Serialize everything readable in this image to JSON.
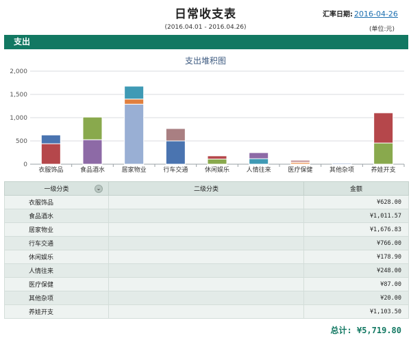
{
  "header": {
    "title": "日常收支表",
    "rate_label": "汇率日期:",
    "rate_date": "2016-04-26",
    "period": "(2016.04.01 - 2016.04.26)",
    "unit": "(单位:元)"
  },
  "section": {
    "title": "支出"
  },
  "chart_data": {
    "type": "bar",
    "stacked": true,
    "title": "支出堆积图",
    "ylim": [
      0,
      2000
    ],
    "yticks": [
      "0",
      "500",
      "1,000",
      "1,500",
      "2,000"
    ],
    "grid": true,
    "categories": [
      "衣服饰品",
      "食品酒水",
      "居家物业",
      "行车交通",
      "休闲娱乐",
      "人情往来",
      "医疗保健",
      "其他杂项",
      "养娃开支"
    ],
    "stacks": [
      [
        {
          "v": 440,
          "c": "#b5474b"
        },
        {
          "v": 188,
          "c": "#4a74b0"
        }
      ],
      [
        {
          "v": 526,
          "c": "#8d6aa6"
        },
        {
          "v": 486,
          "c": "#89a94d"
        }
      ],
      [
        {
          "v": 1290,
          "c": "#99afd4"
        },
        {
          "v": 110,
          "c": "#e07f3e"
        },
        {
          "v": 277,
          "c": "#3f9ab5"
        }
      ],
      [
        {
          "v": 500,
          "c": "#4a74b0"
        },
        {
          "v": 266,
          "c": "#a97f82"
        }
      ],
      [
        {
          "v": 110,
          "c": "#89a94d"
        },
        {
          "v": 69,
          "c": "#b5474b"
        }
      ],
      [
        {
          "v": 118,
          "c": "#3f9ab5"
        },
        {
          "v": 130,
          "c": "#8d6aa6"
        }
      ],
      [
        {
          "v": 40,
          "c": "#f0a66f"
        },
        {
          "v": 47,
          "c": "#c99a9d"
        }
      ],
      [
        {
          "v": 20,
          "c": "#4a74b0"
        }
      ],
      [
        {
          "v": 455,
          "c": "#89a94d"
        },
        {
          "v": 649,
          "c": "#b5474b"
        }
      ]
    ]
  },
  "table": {
    "headers": [
      "一级分类",
      "二级分类",
      "金额"
    ],
    "sort_icon": "double-chevron-down-icon",
    "rows": [
      {
        "cat": "衣服饰品",
        "sub": "",
        "amount": "¥628.00"
      },
      {
        "cat": "食品酒水",
        "sub": "",
        "amount": "¥1,011.57"
      },
      {
        "cat": "居家物业",
        "sub": "",
        "amount": "¥1,676.83"
      },
      {
        "cat": "行车交通",
        "sub": "",
        "amount": "¥766.00"
      },
      {
        "cat": "休闲娱乐",
        "sub": "",
        "amount": "¥178.90"
      },
      {
        "cat": "人情往来",
        "sub": "",
        "amount": "¥248.00"
      },
      {
        "cat": "医疗保健",
        "sub": "",
        "amount": "¥87.00"
      },
      {
        "cat": "其他杂项",
        "sub": "",
        "amount": "¥20.00"
      },
      {
        "cat": "养娃开支",
        "sub": "",
        "amount": "¥1,103.50"
      }
    ]
  },
  "total": "总计: ¥5,719.80"
}
